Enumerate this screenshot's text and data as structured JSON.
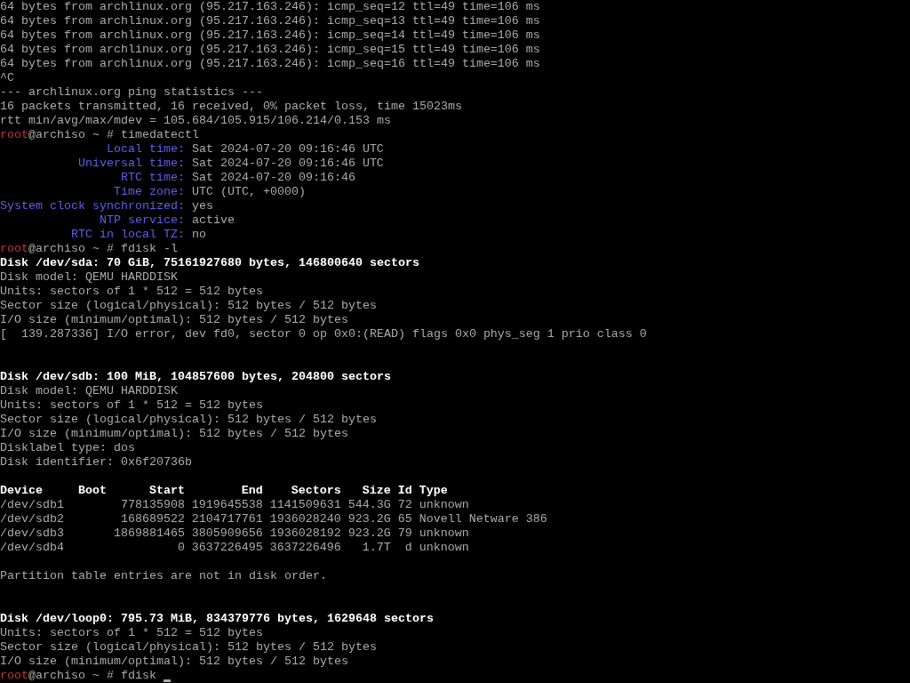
{
  "lines": [
    {
      "kind": "text",
      "text": "64 bytes from archlinux.org (95.217.163.246): icmp_seq=12 ttl=49 time=106 ms"
    },
    {
      "kind": "text",
      "text": "64 bytes from archlinux.org (95.217.163.246): icmp_seq=13 ttl=49 time=106 ms"
    },
    {
      "kind": "text",
      "text": "64 bytes from archlinux.org (95.217.163.246): icmp_seq=14 ttl=49 time=106 ms"
    },
    {
      "kind": "text",
      "text": "64 bytes from archlinux.org (95.217.163.246): icmp_seq=15 ttl=49 time=106 ms"
    },
    {
      "kind": "text",
      "text": "64 bytes from archlinux.org (95.217.163.246): icmp_seq=16 ttl=49 time=106 ms"
    },
    {
      "kind": "text",
      "text": "^C"
    },
    {
      "kind": "text",
      "text": "--- archlinux.org ping statistics ---"
    },
    {
      "kind": "text",
      "text": "16 packets transmitted, 16 received, 0% packet loss, time 15023ms"
    },
    {
      "kind": "text",
      "text": "rtt min/avg/max/mdev = 105.684/105.915/106.214/0.153 ms"
    },
    {
      "kind": "prompt",
      "user": "root",
      "host": "@archiso ~ #",
      "command": "timedatectl"
    },
    {
      "kind": "field",
      "label": "Local time:",
      "value": "Sat 2024-07-20 09:16:46 UTC"
    },
    {
      "kind": "field",
      "label": "Universal time:",
      "value": "Sat 2024-07-20 09:16:46 UTC"
    },
    {
      "kind": "field",
      "label": "RTC time:",
      "value": "Sat 2024-07-20 09:16:46"
    },
    {
      "kind": "field",
      "label": "Time zone:",
      "value": "UTC (UTC, +0000)"
    },
    {
      "kind": "field",
      "label": "System clock synchronized:",
      "value": "yes"
    },
    {
      "kind": "field",
      "label": "NTP service:",
      "value": "active"
    },
    {
      "kind": "field",
      "label": "RTC in local TZ:",
      "value": "no"
    },
    {
      "kind": "prompt",
      "user": "root",
      "host": "@archiso ~ #",
      "command": "fdisk -l"
    },
    {
      "kind": "heading",
      "text": "Disk /dev/sda: 70 GiB, 75161927680 bytes, 146800640 sectors"
    },
    {
      "kind": "text",
      "text": "Disk model: QEMU HARDDISK"
    },
    {
      "kind": "text",
      "text": "Units: sectors of 1 * 512 = 512 bytes"
    },
    {
      "kind": "text",
      "text": "Sector size (logical/physical): 512 bytes / 512 bytes"
    },
    {
      "kind": "text",
      "text": "I/O size (minimum/optimal): 512 bytes / 512 bytes"
    },
    {
      "kind": "text",
      "text": "[  139.287336] I/O error, dev fd0, sector 0 op 0x0:(READ) flags 0x0 phys_seg 1 prio class 0"
    },
    {
      "kind": "blank"
    },
    {
      "kind": "blank"
    },
    {
      "kind": "heading",
      "text": "Disk /dev/sdb: 100 MiB, 104857600 bytes, 204800 sectors"
    },
    {
      "kind": "text",
      "text": "Disk model: QEMU HARDDISK"
    },
    {
      "kind": "text",
      "text": "Units: sectors of 1 * 512 = 512 bytes"
    },
    {
      "kind": "text",
      "text": "Sector size (logical/physical): 512 bytes / 512 bytes"
    },
    {
      "kind": "text",
      "text": "I/O size (minimum/optimal): 512 bytes / 512 bytes"
    },
    {
      "kind": "text",
      "text": "Disklabel type: dos"
    },
    {
      "kind": "text",
      "text": "Disk identifier: 0x6f20736b"
    },
    {
      "kind": "blank"
    },
    {
      "kind": "table",
      "columns": [
        "Device",
        "Boot",
        "Start",
        "End",
        "Sectors",
        "Size",
        "Id",
        "Type"
      ],
      "rows": [
        [
          "/dev/sdb1",
          "",
          "778135908",
          "1919645538",
          "1141509631",
          "544.3G",
          "72",
          "unknown"
        ],
        [
          "/dev/sdb2",
          "",
          "168689522",
          "2104717761",
          "1936028240",
          "923.2G",
          "65",
          "Novell Netware 386"
        ],
        [
          "/dev/sdb3",
          "",
          "1869881465",
          "3805909656",
          "1936028192",
          "923.2G",
          "79",
          "unknown"
        ],
        [
          "/dev/sdb4",
          "",
          "0",
          "3637226495",
          "3637226496",
          "1.7T",
          "d",
          "unknown"
        ]
      ]
    },
    {
      "kind": "blank"
    },
    {
      "kind": "text",
      "text": "Partition table entries are not in disk order."
    },
    {
      "kind": "blank"
    },
    {
      "kind": "blank"
    },
    {
      "kind": "heading",
      "text": "Disk /dev/loop0: 795.73 MiB, 834379776 bytes, 1629648 sectors"
    },
    {
      "kind": "text",
      "text": "Units: sectors of 1 * 512 = 512 bytes"
    },
    {
      "kind": "text",
      "text": "Sector size (logical/physical): 512 bytes / 512 bytes"
    },
    {
      "kind": "text",
      "text": "I/O size (minimum/optimal): 512 bytes / 512 bytes"
    },
    {
      "kind": "prompt",
      "user": "root",
      "host": "@archiso ~ #",
      "command": "fdisk",
      "cursor": true
    }
  ]
}
